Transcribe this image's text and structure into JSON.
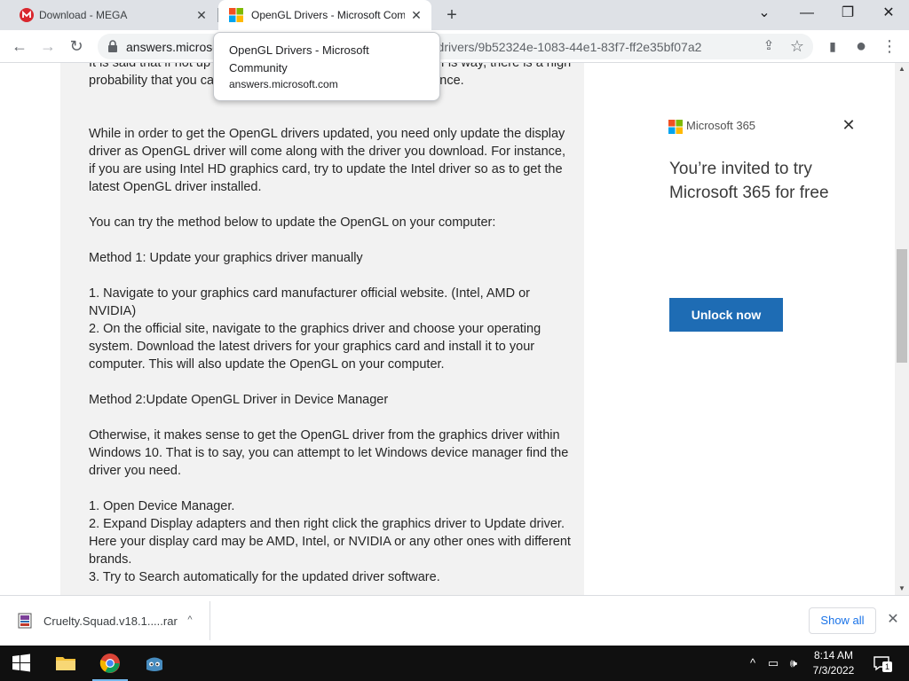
{
  "browser": {
    "tabs": [
      {
        "title": "Download - MEGA",
        "favicon": "mega-icon",
        "active": false
      },
      {
        "title": "OpenGL Drivers - Microsoft Com",
        "favicon": "microsoft-logo-icon",
        "active": true
      }
    ],
    "tab_close_glyph": "✕",
    "new_tab_glyph": "+",
    "window_controls": {
      "tab_search": "⌄",
      "minimize": "—",
      "restore": "❐",
      "close": "✕"
    },
    "toolbar": {
      "back": "←",
      "forward": "→",
      "reload": "↻",
      "share": "⇪",
      "bookmark": "☆",
      "side_panel": "▮",
      "profile": "●",
      "menu": "⋮"
    },
    "address": {
      "visible_prefix": "answers.microso",
      "visible_suffix": "t-drivers/9b52324e-1083-44e1-83f7-ff2e35bf07a2"
    },
    "tooltip": {
      "title": "OpenGL Drivers - Microsoft Community",
      "host": "answers.microsoft.com"
    }
  },
  "article": {
    "paragraphs": [
      "It is said that if not up                                                   ll automatically set the OpenGL to its def                                          is way, there is a high probability that you can't enjoy the maximized gaming experience.",
      "While in order to get the OpenGL drivers updated, you need only update the display driver as OpenGL driver will come along with the driver you download. For instance, if you are using Intel HD graphics card, try to update the Intel driver so as to get the latest OpenGL driver installed.",
      "You can try the method below to update the OpenGL on your computer:",
      "Method 1: Update your graphics driver manually",
      "1. Navigate to your graphics card manufacturer official website. (Intel, AMD or NVIDIA)\n2. On the official site, navigate to the graphics driver and choose your operating system. Download the latest drivers for your graphics card and install it to your computer. This will also update the OpenGL on your computer.",
      "Method 2:Update OpenGL Driver in Device Manager",
      "Otherwise, it makes sense to get the OpenGL driver from the graphics driver within Windows 10. That is to say, you can attempt to let Windows device manager find the driver you need.",
      "1. Open Device Manager.\n2. Expand Display adapters and then right click the graphics driver to Update driver. Here your display card may be AMD, Intel, or NVIDIA or any other ones with different brands.\n3. Try to Search automatically for the updated driver software."
    ]
  },
  "ad": {
    "brand": "Microsoft 365",
    "close_glyph": "✕",
    "headline": "You’re invited to try Microsoft 365 for free",
    "cta": "Unlock now"
  },
  "scrollbar": {
    "up": "▲",
    "down": "▼"
  },
  "download_shelf": {
    "file_name": "Cruelty.Squad.v18.1.....rar",
    "chevron": "^",
    "show_all": "Show all",
    "close_glyph": "✕"
  },
  "taskbar": {
    "pinned": [
      "windows-start-icon",
      "file-explorer-icon",
      "chrome-icon",
      "godot-icon"
    ],
    "tray": {
      "chevron": "^",
      "network": "▭",
      "volume": "🕪"
    },
    "time": "8:14 AM",
    "date": "7/3/2022",
    "notification_count": "1"
  },
  "colors": {
    "tabstrip_bg": "#dee1e6",
    "article_bg": "#f2f2f2",
    "cta_blue": "#1e6cb4",
    "taskbar_bg": "#101010",
    "link_blue": "#1a73e8"
  }
}
